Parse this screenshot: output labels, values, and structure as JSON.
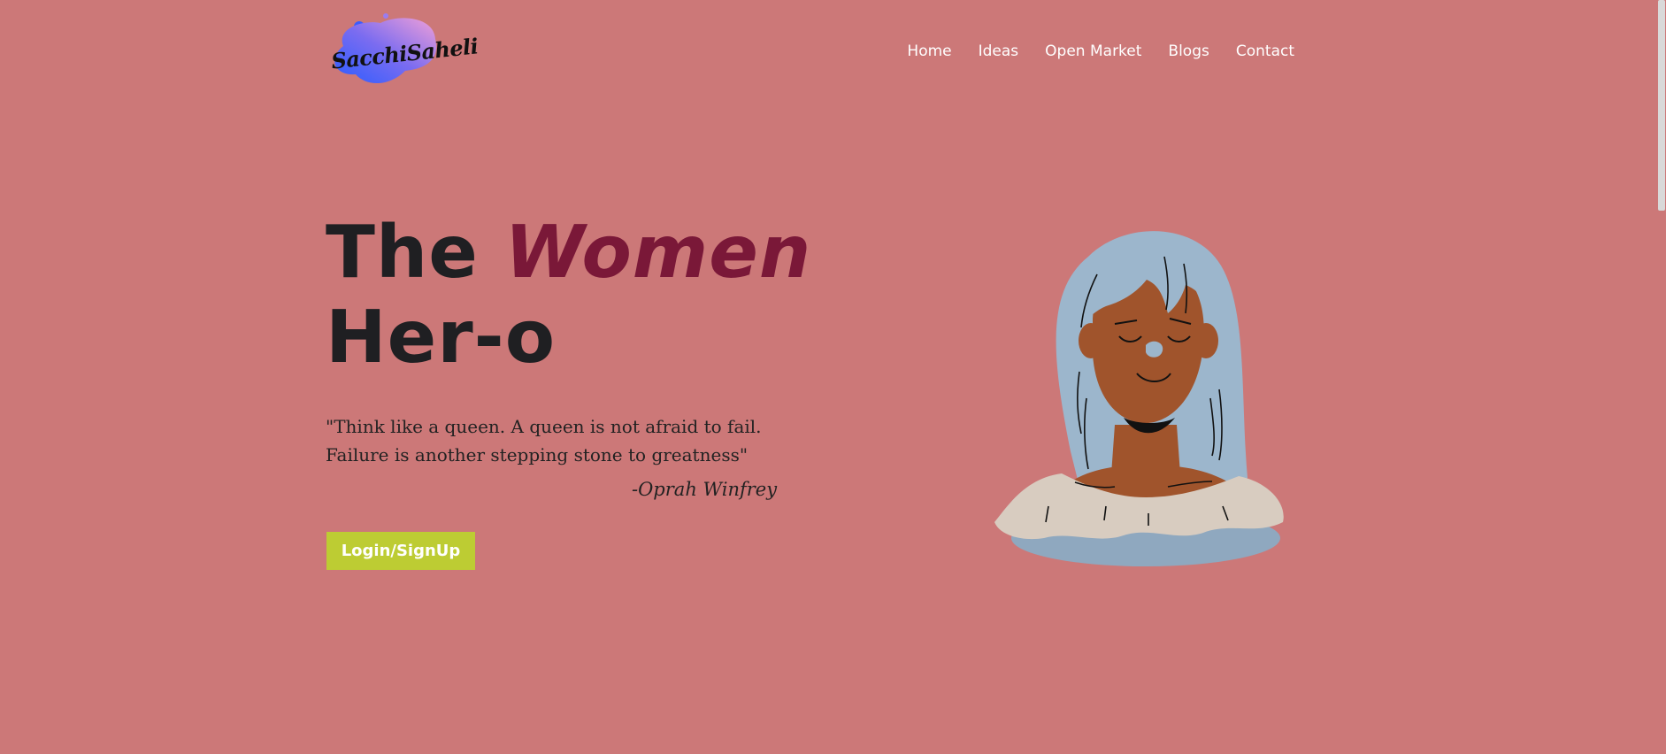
{
  "header": {
    "logo_text": "SacchiSaheli",
    "nav": [
      {
        "label": "Home"
      },
      {
        "label": "Ideas"
      },
      {
        "label": "Open Market"
      },
      {
        "label": "Blogs"
      },
      {
        "label": "Contact"
      }
    ]
  },
  "hero": {
    "title_part1": "The",
    "title_accent": "Women",
    "title_part2": "Her-o",
    "quote": "\"Think like a queen. A queen is not afraid to fail. Failure is another stepping stone to greatness\"",
    "author": "-Oprah Winfrey",
    "cta_label": "Login/SignUp"
  },
  "colors": {
    "background": "#cc7878",
    "accent": "#7a1838",
    "button": "#bdcc33"
  }
}
